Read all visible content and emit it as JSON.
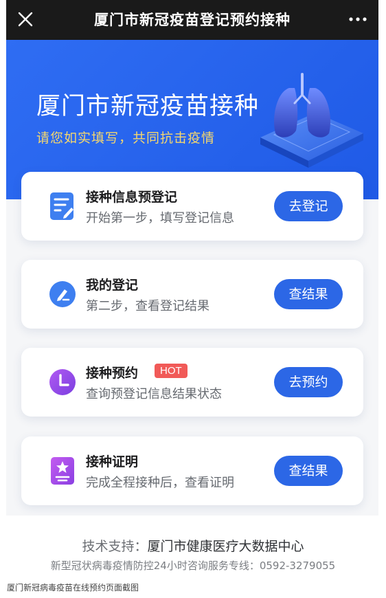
{
  "topbar": {
    "title": "厦门市新冠疫苗登记预约接种",
    "close_icon": "close-icon",
    "more_icon": "more-dots-icon"
  },
  "hero": {
    "headline": "厦门市新冠疫苗接种",
    "subline": "请您如实填写，共同抗击疫情",
    "illustration": "lung-illustration",
    "colors": {
      "background": "#2f6df3",
      "subline": "#f5d76e"
    }
  },
  "cards": [
    {
      "name": "接种信息预登记",
      "desc": "开始第一步，填写登记信息",
      "button": "去登记",
      "icon": "form-edit-icon"
    },
    {
      "name": "我的登记",
      "desc": "第二步，查看登记结果",
      "button": "查结果",
      "icon": "pen-circle-icon"
    },
    {
      "name": "接种预约",
      "badge": "HOT",
      "desc": "查询预登记信息结果状态",
      "button": "去预约",
      "icon": "clock-icon"
    },
    {
      "name": "接种证明",
      "desc": "完成全程接种后，查看证明",
      "button": "查结果",
      "icon": "certificate-icon"
    }
  ],
  "footer": {
    "support_label": "技术支持：",
    "support_org": "厦门市健康医疗大数据中心",
    "hotline": "新型冠状病毒疫情防控24小时咨询服务专线：0592-3279055"
  },
  "caption": "厦门新冠病毒疫苗在线预约页面截图",
  "colors": {
    "accent": "#2c67e6",
    "hot": "#f15a58"
  }
}
